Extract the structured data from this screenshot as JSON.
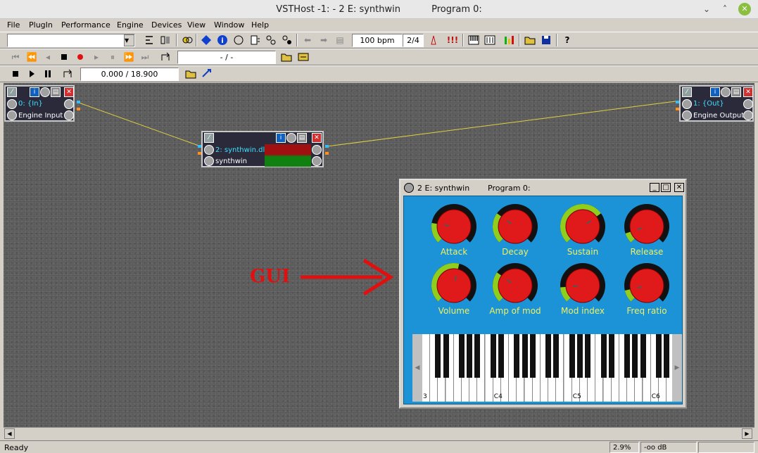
{
  "window": {
    "title": "VSTHost -1:  - 2 E: synthwin",
    "program": "Program 0:"
  },
  "menu": [
    "File",
    "PlugIn",
    "Performance",
    "Engine",
    "Devices",
    "View",
    "Window",
    "Help"
  ],
  "toolbar": {
    "tempo": "100 bpm",
    "signature": "2/4",
    "position": "- / -",
    "time": "0.000 / 18.900"
  },
  "nodes": {
    "input": {
      "id": "0: {In}",
      "name": "Engine Input"
    },
    "plugin": {
      "id": "2: synthwin.dll",
      "name": "synthwin"
    },
    "output": {
      "id": "1: {Out}",
      "name": "Engine Output"
    }
  },
  "plugin_window": {
    "title": "2 E: synthwin",
    "program": "Program 0:",
    "knobs": [
      {
        "label": "Attack",
        "value": 0.2
      },
      {
        "label": "Decay",
        "value": 0.3
      },
      {
        "label": "Sustain",
        "value": 0.7
      },
      {
        "label": "Release",
        "value": 0.1
      },
      {
        "label": "Volume",
        "value": 0.55
      },
      {
        "label": "Amp of mod",
        "value": 0.3
      },
      {
        "label": "Mod index",
        "value": 0.15
      },
      {
        "label": "Freq ratio",
        "value": 0.12
      }
    ],
    "keyboard_labels": [
      "3",
      "C4",
      "C5",
      "C6"
    ]
  },
  "annotation": {
    "text": "GUI"
  },
  "status": {
    "text": "Ready",
    "cpu": "2.9%",
    "level": "-oo dB"
  },
  "colors": {
    "panel": "#1c93d6",
    "knob_red": "#e01a1a",
    "knob_arc": "#8fce1c",
    "label_yellow": "#f0f060",
    "cable": "#e0d040",
    "annotation_red": "#e01010"
  }
}
